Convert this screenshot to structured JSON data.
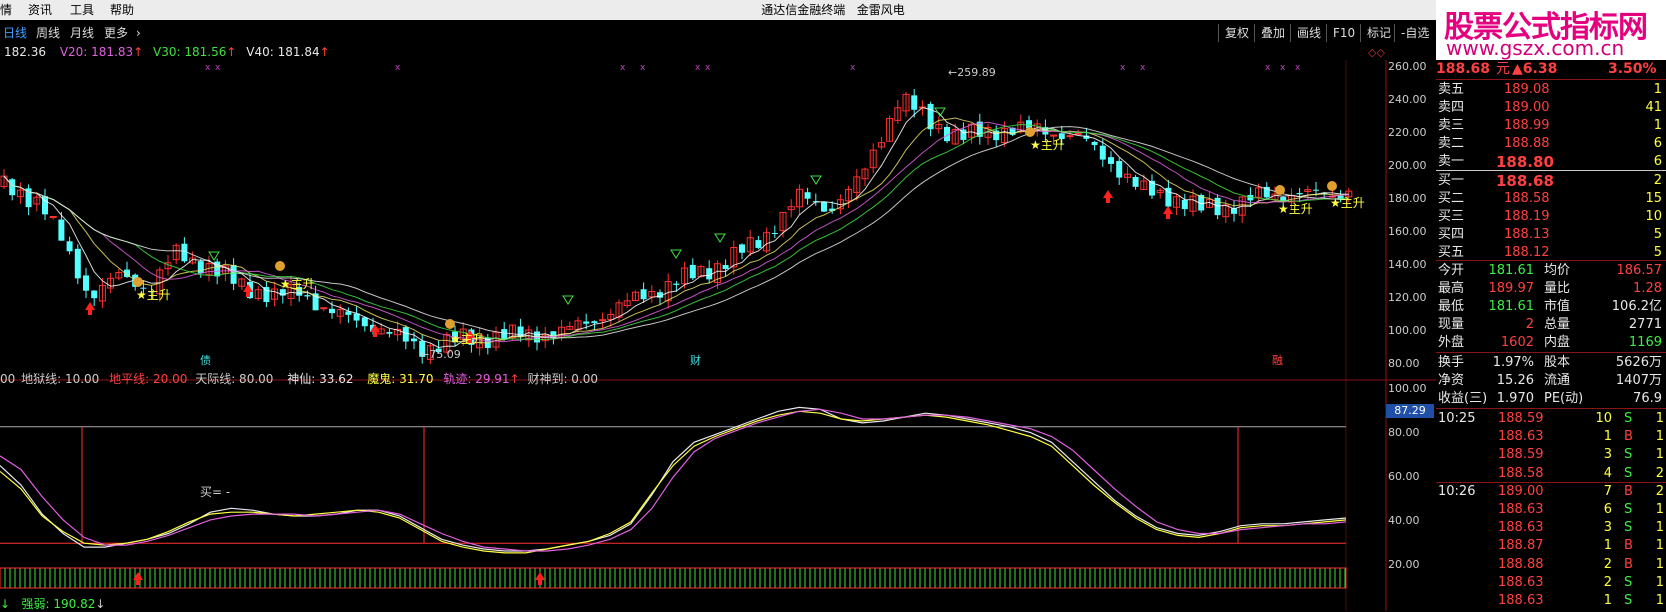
{
  "menubar": {
    "items": [
      "情",
      "资讯",
      "工具",
      "帮助"
    ],
    "app_title": "通达信金融终端",
    "stock_name": "金雷风电"
  },
  "toolbar": {
    "ma_prefix": "182.36",
    "ma": [
      {
        "label": "V20: 181.83",
        "color": "#e060e0"
      },
      {
        "label": "V30: 181.56",
        "color": "#40e040"
      },
      {
        "label": "V40: 181.84",
        "color": "#e8e8e8"
      }
    ],
    "periods": [
      "日线",
      "周线",
      "月线",
      "更多"
    ],
    "buttons": [
      "复权",
      "叠加",
      "画线",
      "F10",
      "标记",
      "-自选"
    ]
  },
  "logo": {
    "line1": "股票公式指标网",
    "line2": "www.gszx.com.cn"
  },
  "price_chart": {
    "y_ticks": [
      "260.00",
      "240.00",
      "220.00",
      "200.00",
      "180.00",
      "160.00",
      "140.00",
      "120.00",
      "100.00",
      "80.00"
    ],
    "high_label": "259.89",
    "low_label": "75.09",
    "annotations": [
      {
        "text": "★主升"
      },
      {
        "text": "★主升"
      },
      {
        "text": "★主升"
      },
      {
        "text": "★主升"
      },
      {
        "text": "★主升"
      },
      {
        "text": "★主升"
      }
    ],
    "event_labels": [
      "债",
      "财",
      "融"
    ]
  },
  "indicator": {
    "legend": [
      {
        "label": "00",
        "color": "#cccccc"
      },
      {
        "label": "地狱线: 10.00",
        "color": "#cccccc"
      },
      {
        "label": "地平线: 20.00",
        "color": "#ff4040"
      },
      {
        "label": "天际线: 80.00",
        "color": "#cccccc"
      },
      {
        "label": "神仙: 33.62",
        "color": "#e8e8e8"
      },
      {
        "label": "魔鬼: 31.70",
        "color": "#ffff40"
      },
      {
        "label": "轨迹: 29.91",
        "color": "#e060e0"
      },
      {
        "label": "财神到: 0.00",
        "color": "#cccccc"
      }
    ],
    "y_ticks": [
      "100.00",
      "80.00",
      "60.00",
      "40.00",
      "20.00"
    ],
    "current_value": "87.29",
    "buy_label": "买= -",
    "bottom_label": "强弱: 190.82",
    "chart_data": {
      "type": "line",
      "ylim": [
        0,
        100
      ],
      "x": [
        0,
        1,
        2,
        3,
        4,
        5,
        6,
        7,
        8,
        9,
        10,
        11,
        12,
        13,
        14,
        15,
        16,
        17,
        18,
        19,
        20,
        21,
        22,
        23,
        24,
        25,
        26,
        27,
        28,
        29,
        30,
        31,
        32,
        33,
        34,
        35,
        36,
        37,
        38,
        39,
        40,
        41,
        42,
        43,
        44,
        45,
        46,
        47,
        48,
        49,
        50,
        51,
        52,
        53,
        54,
        55,
        56,
        57,
        58,
        59,
        60,
        61,
        62,
        63,
        64
      ],
      "series": [
        {
          "color": "#e8e8e8",
          "values": [
            60,
            50,
            35,
            25,
            18,
            18,
            20,
            22,
            25,
            30,
            36,
            38,
            37,
            35,
            34,
            34,
            35,
            37,
            37,
            34,
            28,
            22,
            19,
            17,
            16,
            16,
            17,
            19,
            21,
            24,
            30,
            45,
            62,
            72,
            76,
            80,
            84,
            88,
            90,
            89,
            84,
            82,
            83,
            85,
            87,
            86,
            84,
            82,
            80,
            77,
            72,
            62,
            52,
            42,
            34,
            28,
            25,
            24,
            26,
            29,
            30,
            30,
            31,
            32,
            33
          ]
        },
        {
          "color": "#ffff40",
          "values": [
            57,
            48,
            34,
            26,
            20,
            19,
            20,
            22,
            26,
            31,
            35,
            36,
            36,
            35,
            34,
            35,
            36,
            37,
            36,
            33,
            27,
            21,
            18,
            16,
            15,
            15,
            17,
            19,
            21,
            25,
            31,
            46,
            60,
            70,
            75,
            79,
            83,
            86,
            88,
            87,
            84,
            83,
            84,
            85,
            86,
            85,
            83,
            81,
            78,
            75,
            70,
            60,
            50,
            41,
            33,
            27,
            24,
            23,
            25,
            28,
            29,
            29,
            30,
            31,
            32
          ]
        },
        {
          "color": "#e060e0",
          "values": [
            65,
            58,
            44,
            32,
            23,
            19,
            19,
            21,
            24,
            28,
            32,
            34,
            35,
            35,
            35,
            34,
            35,
            36,
            37,
            35,
            30,
            25,
            21,
            18,
            17,
            16,
            16,
            17,
            19,
            22,
            27,
            38,
            54,
            67,
            74,
            78,
            82,
            85,
            88,
            89,
            87,
            84,
            84,
            85,
            86,
            86,
            85,
            83,
            81,
            79,
            75,
            68,
            58,
            48,
            39,
            31,
            27,
            25,
            25,
            27,
            28,
            29,
            30,
            30,
            31
          ]
        }
      ]
    }
  },
  "quote": {
    "price": "188.68",
    "unit": "元",
    "change": "▲6.38",
    "pct": "3.50%",
    "sells": [
      {
        "label": "卖五",
        "price": "189.08",
        "vol": "1"
      },
      {
        "label": "卖四",
        "price": "189.00",
        "vol": "41"
      },
      {
        "label": "卖三",
        "price": "188.99",
        "vol": "1"
      },
      {
        "label": "卖二",
        "price": "188.88",
        "vol": "6"
      },
      {
        "label": "卖一",
        "price": "188.80",
        "vol": "6"
      }
    ],
    "buys": [
      {
        "label": "买一",
        "price": "188.68",
        "vol": "2"
      },
      {
        "label": "买二",
        "price": "188.58",
        "vol": "15"
      },
      {
        "label": "买三",
        "price": "188.19",
        "vol": "10"
      },
      {
        "label": "买四",
        "price": "188.13",
        "vol": "5"
      },
      {
        "label": "买五",
        "price": "188.12",
        "vol": "5"
      }
    ],
    "stats": [
      {
        "k1": "今开",
        "v1": "181.61",
        "c1": "gn",
        "k2": "均价",
        "v2": "186.57",
        "c2": "rd"
      },
      {
        "k1": "最高",
        "v1": "189.97",
        "c1": "rd",
        "k2": "量比",
        "v2": "1.28",
        "c2": "rd"
      },
      {
        "k1": "最低",
        "v1": "181.61",
        "c1": "gn",
        "k2": "市值",
        "v2": "106.2亿",
        "c2": "wh"
      },
      {
        "k1": "现量",
        "v1": "2",
        "c1": "rd",
        "k2": "总量",
        "v2": "2771",
        "c2": "wh"
      },
      {
        "k1": "外盘",
        "v1": "1602",
        "c1": "rd",
        "k2": "内盘",
        "v2": "1169",
        "c2": "gn"
      }
    ],
    "stats2": [
      {
        "k1": "换手",
        "v1": "1.97%",
        "c1": "wh",
        "k2": "股本",
        "v2": "5626万",
        "c2": "wh"
      },
      {
        "k1": "净资",
        "v1": "15.26",
        "c1": "wh",
        "k2": "流通",
        "v2": "1407万",
        "c2": "wh"
      },
      {
        "k1": "收益(三)",
        "v1": "1.970",
        "c1": "wh",
        "k2": "PE(动)",
        "v2": "76.9",
        "c2": "wh"
      }
    ],
    "ticks": [
      {
        "time": "10:25",
        "price": "188.59",
        "vol": "10",
        "side": "S"
      },
      {
        "time": "",
        "price": "188.63",
        "vol": "1",
        "side": "B"
      },
      {
        "time": "",
        "price": "188.59",
        "vol": "3",
        "side": "S"
      },
      {
        "time": "",
        "price": "188.58",
        "vol": "4",
        "side": "S"
      },
      {
        "time": "10:26",
        "price": "189.00",
        "vol": "7",
        "side": "B"
      },
      {
        "time": "",
        "price": "188.63",
        "vol": "6",
        "side": "S"
      },
      {
        "time": "",
        "price": "188.63",
        "vol": "3",
        "side": "S"
      },
      {
        "time": "",
        "price": "188.87",
        "vol": "1",
        "side": "B"
      },
      {
        "time": "",
        "price": "188.88",
        "vol": "2",
        "side": "B"
      },
      {
        "time": "",
        "price": "188.63",
        "vol": "2",
        "side": "S"
      },
      {
        "time": "",
        "price": "188.63",
        "vol": "1",
        "side": "S"
      }
    ],
    "right_col": [
      "1",
      "1",
      "1",
      "2",
      "2",
      "1",
      "1",
      "1",
      "1",
      "1",
      "1"
    ]
  }
}
